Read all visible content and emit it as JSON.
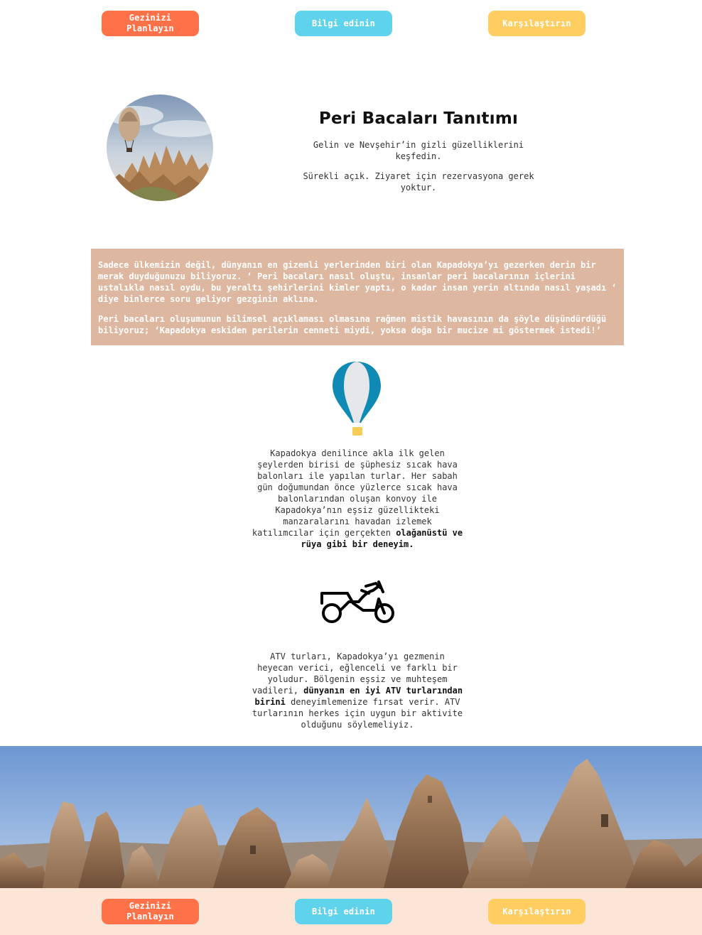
{
  "nav": {
    "plan_label": "Gezinizi Planlayın",
    "info_label": "Bilgi edinin",
    "compare_label": "Karşılaştırın",
    "colors": {
      "plan": "#ff7249",
      "info": "#5fd3ec",
      "compare": "#ffcd60"
    }
  },
  "intro": {
    "title": "Peri Bacaları Tanıtımı",
    "subtitle": "Gelin ve Nevşehir’in gizli güzelliklerini keşfedin.",
    "hours": "Sürekli açık. Ziyaret için rezervasyona gerek yoktur."
  },
  "story": {
    "p1": "Sadece ülkemizin değil, dünyanın en gizemli yerlerinden biri olan Kapadokya’yı gezerken derin bir merak duyduğunuzu biliyoruz. ‘ Peri bacaları nasıl oluştu, insanlar peri bacalarının içlerini ustalıkla nasıl oydu, bu yeraltı şehirlerini kimler yaptı, o kadar insan yerin altında nasıl yaşadı ‘ diye binlerce soru geliyor gezginin aklına.",
    "p2": "Peri bacaları oluşumunun bilimsel açıklaması olmasına rağmen mistik havasının da şöyle düşündürdüğü biliyoruz; ‘Kapadokya eskiden perilerin cenneti miydi, yoksa doğa bir mucize mi göstermek istedi!’",
    "background": "#ddb7a0"
  },
  "balloon_feature": {
    "text": "Kapadokya denilince akla ilk gelen şeylerden birisi de şüphesiz sıcak hava balonları ile yapılan turlar. Her sabah gün doğumundan önce yüzlerce sıcak hava balonlarından oluşan konvoy ile Kapadokya’nın eşsiz güzellikteki manzaralarını havadan izlemek katılımcılar için gerçekten ",
    "bold": "olağanüstü ve rüya gibi bir deneyim."
  },
  "atv_feature": {
    "text_before": "ATV turları, Kapadokya’yı gezmenin heyecan verici, eğlenceli ve farklı bir yoludur. Bölgenin eşsiz ve muhteşem vadileri, ",
    "bold": "dünyanın en iyi ATV turlarından birini",
    "text_after": " deneyimlemenize fırsat verir. ATV turlarının herkes için uygun bir aktivite olduğunu söylemeliyiz."
  }
}
